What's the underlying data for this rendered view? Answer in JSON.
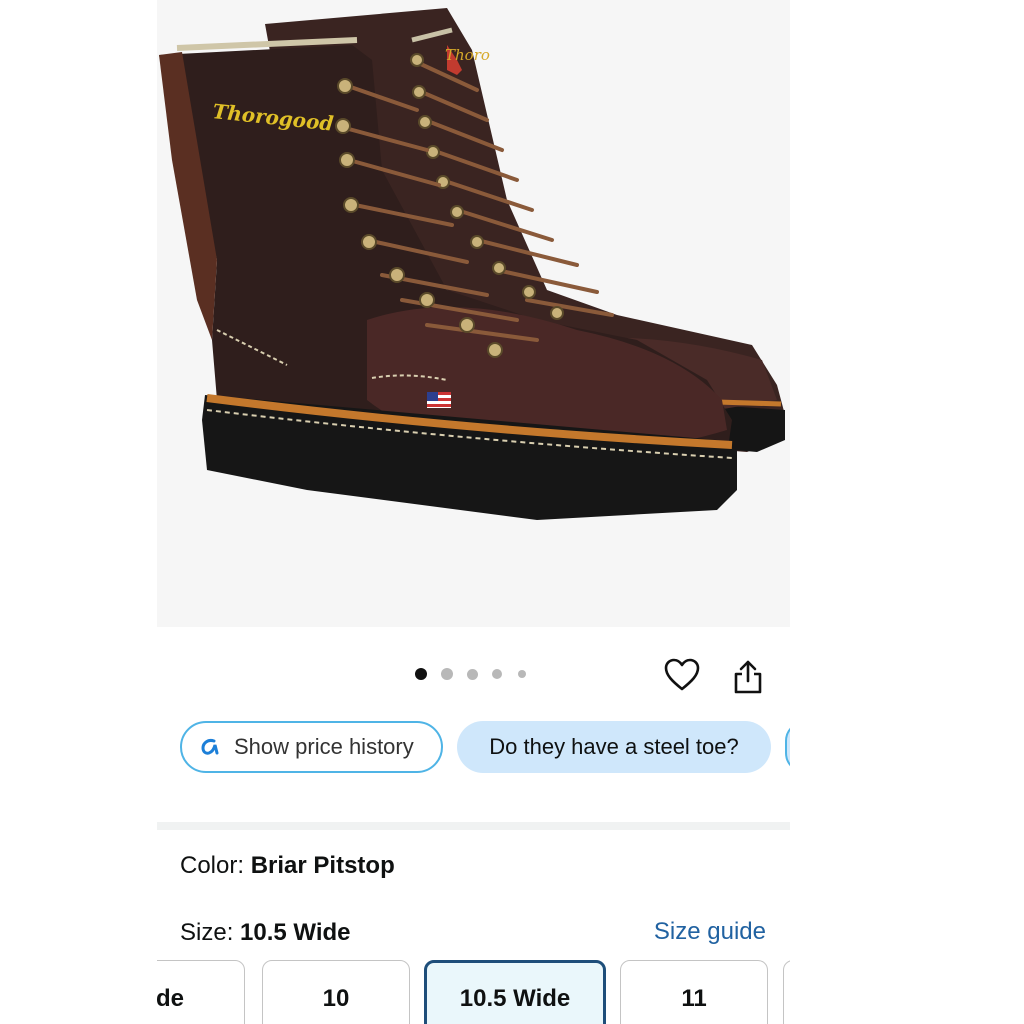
{
  "product_image": {
    "alt": "Thorogood work boots",
    "brand_logo_text": "Thorogood",
    "carousel": {
      "total": 5,
      "active_index": 0
    }
  },
  "actions": {
    "wishlist_icon": "heart-icon",
    "share_icon": "share-icon"
  },
  "chips": {
    "price_history_label": "Show price history",
    "question_label": "Do they have a steel toe?"
  },
  "color": {
    "label": "Color:",
    "value": "Briar Pitstop"
  },
  "size": {
    "label": "Size:",
    "value": "10.5 Wide",
    "guide_link": "Size guide",
    "options": [
      "Wide",
      "10",
      "10.5 Wide",
      "11"
    ],
    "selected": "10.5 Wide"
  },
  "colors": {
    "link": "#2162a1",
    "chip_border": "#4fb4e6",
    "chip_fill": "#cfe7fb",
    "selected_border": "#1e4e7a",
    "selected_fill": "#eaf7fb"
  }
}
